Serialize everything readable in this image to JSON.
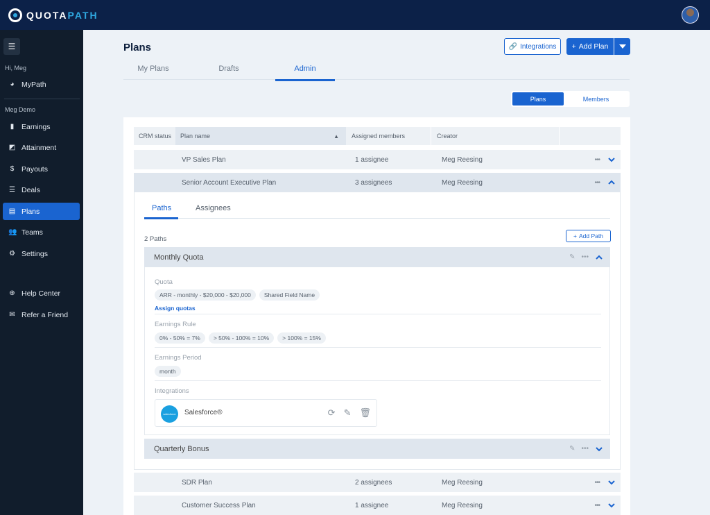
{
  "brand": {
    "name_a": "QUOTA",
    "name_b": "PATH"
  },
  "sidebar": {
    "greeting": "Hi, Meg",
    "mypath": "MyPath",
    "org": "Meg Demo",
    "items": [
      {
        "label": "Earnings",
        "icon": "bar-chart-icon"
      },
      {
        "label": "Attainment",
        "icon": "trend-icon"
      },
      {
        "label": "Payouts",
        "icon": "dollar-icon"
      },
      {
        "label": "Deals",
        "icon": "checklist-icon"
      },
      {
        "label": "Plans",
        "icon": "document-icon",
        "active": true
      },
      {
        "label": "Teams",
        "icon": "users-icon"
      },
      {
        "label": "Settings",
        "icon": "gear-icon"
      }
    ],
    "help": "Help Center",
    "refer": "Refer a Friend"
  },
  "header": {
    "title": "Plans",
    "integrations_label": "Integrations",
    "add_plan_label": "Add Plan",
    "tabs": [
      "My Plans",
      "Drafts",
      "Admin"
    ],
    "active_tab": "Admin",
    "segment": [
      "Plans",
      "Members"
    ],
    "active_segment": "Plans"
  },
  "table": {
    "columns": [
      "CRM status",
      "Plan name",
      "Assigned members",
      "Creator"
    ],
    "sort_indicator": "▲",
    "rows": [
      {
        "name": "VP Sales Plan",
        "members": "1 assignee",
        "creator": "Meg Reesing",
        "expanded": false
      },
      {
        "name": "Senior Account Executive Plan",
        "members": "3 assignees",
        "creator": "Meg Reesing",
        "expanded": true
      },
      {
        "name": "SDR Plan",
        "members": "2 assignees",
        "creator": "Meg Reesing",
        "expanded": false
      },
      {
        "name": "Customer Success Plan",
        "members": "1 assignee",
        "creator": "Meg Reesing",
        "expanded": false
      }
    ]
  },
  "detail": {
    "tabs": [
      "Paths",
      "Assignees"
    ],
    "active_tab": "Paths",
    "paths_count": "2 Paths",
    "add_path_label": "Add Path",
    "paths": [
      {
        "name": "Monthly Quota",
        "quota_label": "Quota",
        "quota_chips": [
          "ARR - monthly - $20,000 - $20,000",
          "Shared Field Name"
        ],
        "assign_link": "Assign quotas",
        "earnings_rule_label": "Earnings Rule",
        "earnings_rule_chips": [
          "0% - 50% = 7%",
          "> 50% - 100% = 10%",
          "> 100% = 15%"
        ],
        "earnings_period_label": "Earnings Period",
        "earnings_period_chips": [
          "month"
        ],
        "integrations_label": "Integrations",
        "integration": {
          "name": "Salesforce®",
          "logo_text": "salesforce"
        }
      },
      {
        "name": "Quarterly Bonus"
      }
    ]
  }
}
